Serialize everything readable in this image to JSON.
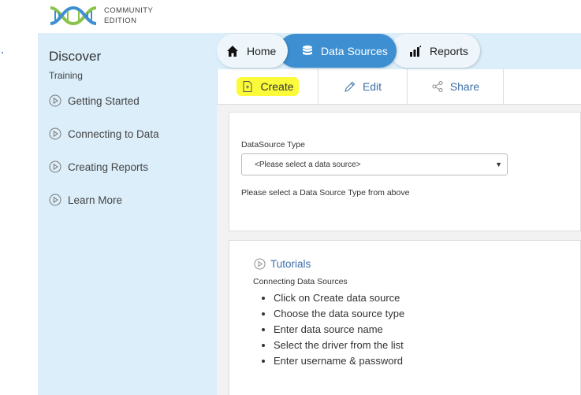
{
  "header": {
    "edition_line1": "COMMUNITY",
    "edition_line2": "EDITION"
  },
  "sidebar": {
    "title": "Discover",
    "subtitle": "Training",
    "items": [
      {
        "label": "Getting Started"
      },
      {
        "label": "Connecting to Data"
      },
      {
        "label": "Creating Reports"
      },
      {
        "label": "Learn More"
      }
    ]
  },
  "nav": {
    "home": "Home",
    "data_sources": "Data Sources",
    "reports": "Reports"
  },
  "tabs": {
    "create": "Create",
    "edit": "Edit",
    "share": "Share"
  },
  "form": {
    "label": "DataSource Type",
    "select_value": "<Please select a data source>",
    "help": "Please select a Data Source Type from above"
  },
  "tutorials": {
    "title": "Tutorials",
    "subtitle": "Connecting Data Sources",
    "steps": [
      "Click on Create data source",
      "Choose the data source type",
      "Enter data source name",
      "Select the driver from the list",
      "Enter username & password"
    ]
  },
  "colors": {
    "accent": "#3d8fd1",
    "sidebar_bg": "#dbeefa",
    "highlight": "#fbfb3a",
    "link": "#3d6fa8"
  }
}
